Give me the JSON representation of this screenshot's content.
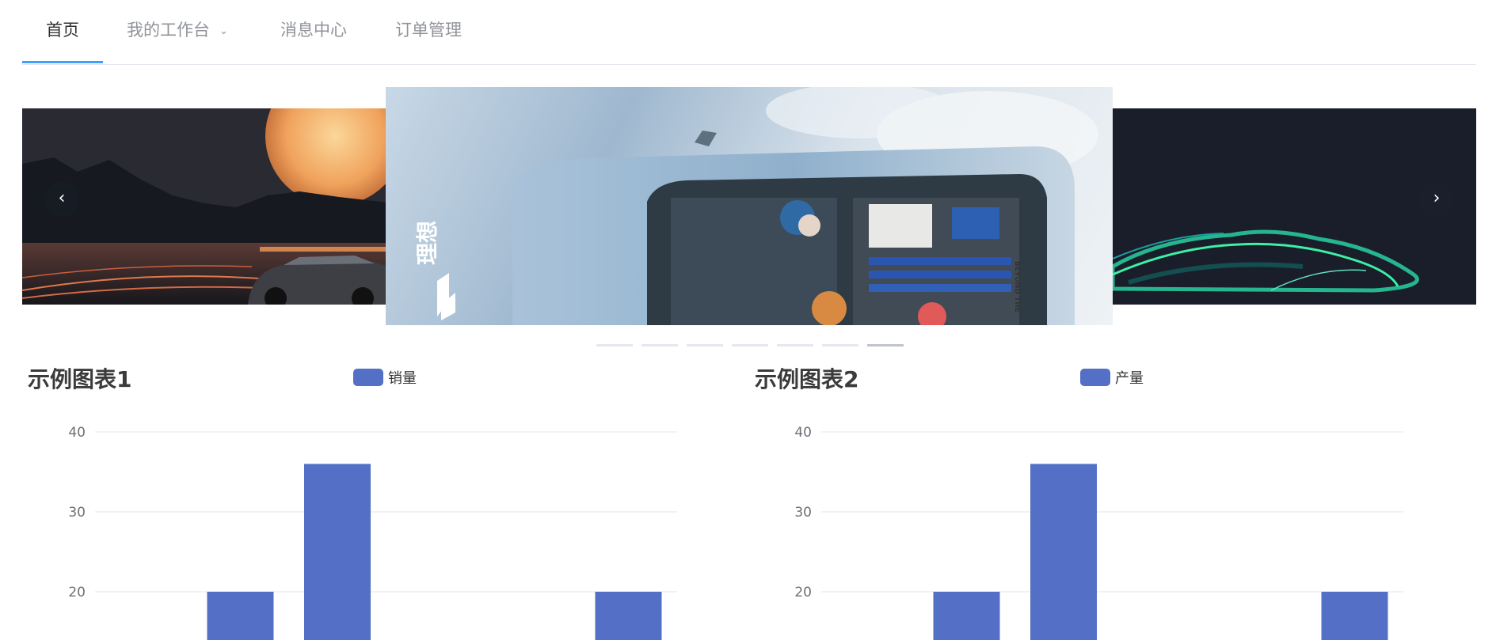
{
  "nav": {
    "items": [
      {
        "label": "首页",
        "active": true
      },
      {
        "label": "我的工作台",
        "active": false,
        "has_dropdown": true
      },
      {
        "label": "消息中心",
        "active": false
      },
      {
        "label": "订单管理",
        "active": false
      }
    ],
    "accent_color": "#409eff"
  },
  "carousel": {
    "slides": [
      {
        "description": "sunset car photo"
      },
      {
        "logo_text": "理想",
        "side_text": "BEYOND THE"
      },
      {
        "description": "green light car outline"
      }
    ],
    "indicator_count": 7,
    "active_indicator": 7
  },
  "chart_data": [
    {
      "type": "bar",
      "title": "示例图表1",
      "legend": [
        "销量"
      ],
      "series": [
        {
          "name": "销量",
          "values": [
            null,
            20,
            36,
            null,
            null,
            20
          ],
          "color": "#5470c6"
        }
      ],
      "yticks": [
        40,
        30,
        20
      ],
      "ylim_visible": [
        20,
        40
      ]
    },
    {
      "type": "bar",
      "title": "示例图表2",
      "legend": [
        "产量"
      ],
      "series": [
        {
          "name": "产量",
          "values": [
            null,
            20,
            36,
            null,
            null,
            20
          ],
          "color": "#5470c6"
        }
      ],
      "yticks": [
        40,
        30,
        20
      ],
      "ylim_visible": [
        20,
        40
      ]
    }
  ]
}
